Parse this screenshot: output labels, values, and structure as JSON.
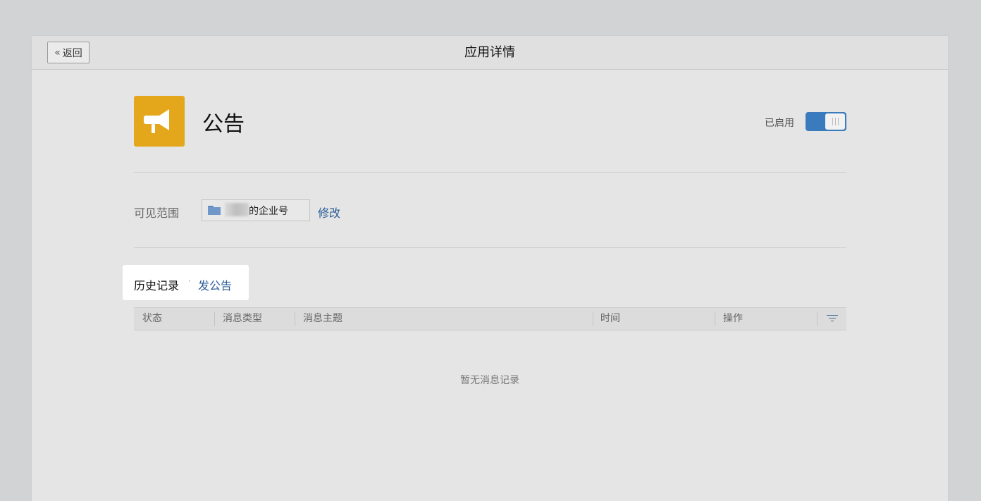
{
  "header": {
    "back_label": "返回",
    "title": "应用详情"
  },
  "app": {
    "name": "公告",
    "icon": "megaphone-icon",
    "icon_color": "#e4a71b",
    "status_label": "已启用",
    "enabled": true,
    "toggle_color": "#3a7bbd"
  },
  "scope": {
    "label": "可见范围",
    "value": "的企业号",
    "edit_label": "修改"
  },
  "tabs": {
    "history": "历史记录",
    "separator": "·",
    "post": "发公告"
  },
  "table": {
    "columns": [
      "状态",
      "消息类型",
      "消息主题",
      "时间",
      "操作"
    ],
    "empty_message": "暂无消息记录"
  },
  "colors": {
    "link": "#2a5d96",
    "page_bg": "#e5e5e5"
  }
}
